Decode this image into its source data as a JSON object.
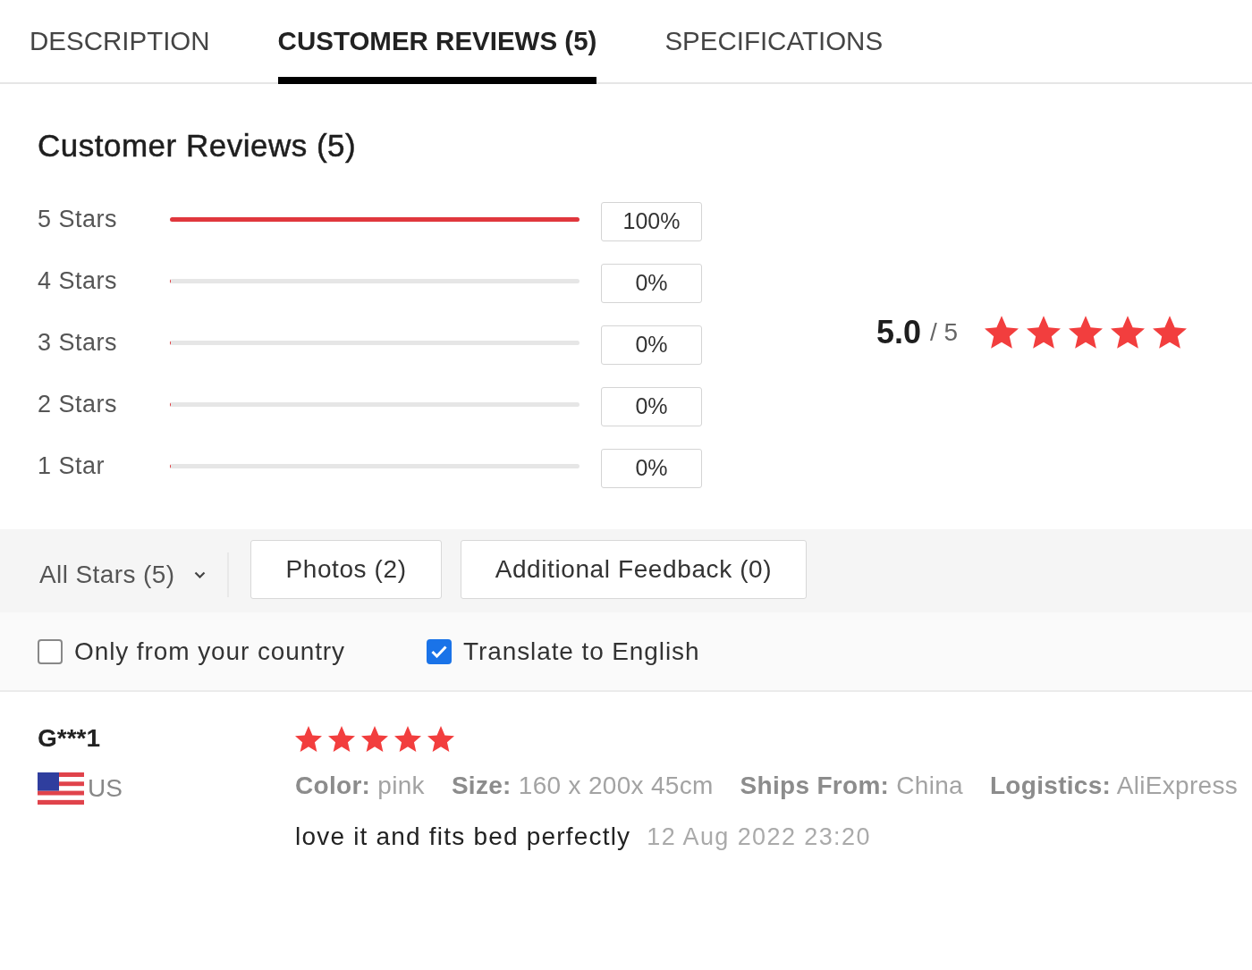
{
  "tabs": [
    {
      "label": "DESCRIPTION",
      "selected": false
    },
    {
      "label": "CUSTOMER REVIEWS (5)",
      "selected": true
    },
    {
      "label": "SPECIFICATIONS",
      "selected": false
    }
  ],
  "summary": {
    "title": "Customer Reviews (5)",
    "breakdown": [
      {
        "label": "5 Stars",
        "level": 1,
        "percent": "100%"
      },
      {
        "label": "4 Stars",
        "level": 0,
        "percent": "0%"
      },
      {
        "label": "3 Stars",
        "level": 0,
        "percent": "0%"
      },
      {
        "label": "2 Stars",
        "level": 0,
        "percent": "0%"
      },
      {
        "label": "1 Star",
        "level": 0,
        "percent": "0%"
      }
    ],
    "average": "5.0",
    "scale": "/ 5",
    "stars": 5
  },
  "filters": {
    "dropdown": {
      "label": "All Stars (5)"
    },
    "buttons": [
      "Photos (2)",
      "Additional Feedback (0)"
    ],
    "options": [
      {
        "label": "Only from your country",
        "checked": false
      },
      {
        "label": "Translate to English",
        "checked": true
      }
    ]
  },
  "reviews": [
    {
      "name": "G***1",
      "country": "US",
      "stars": 5,
      "attributes": [
        "**Color:** pink",
        "**Size:** 160 x 200x 45cm",
        "**Ships From:** China",
        "**Logistics:** AliExpress"
      ],
      "comment": "love it and fits bed perfectly",
      "date": "12 Aug 2022 23:20"
    }
  ]
}
